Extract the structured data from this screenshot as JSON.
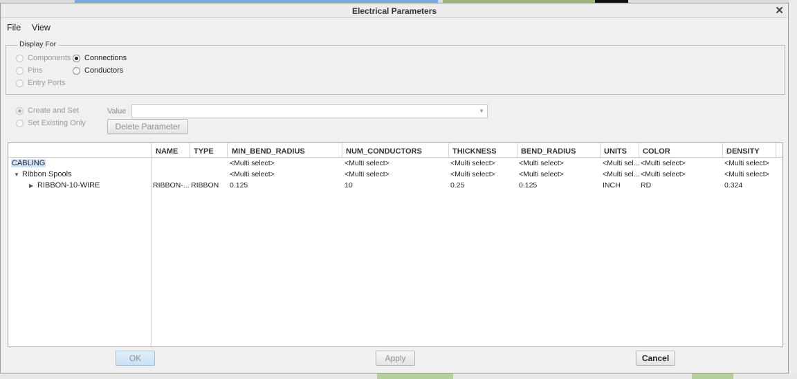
{
  "dialog": {
    "title": "Electrical Parameters"
  },
  "menu": {
    "file": "File",
    "view": "View"
  },
  "display_for": {
    "legend": "Display For",
    "options": [
      {
        "label": "Components",
        "checked": false,
        "enabled": false
      },
      {
        "label": "Connections",
        "checked": true,
        "enabled": true
      },
      {
        "label": "Pins",
        "checked": false,
        "enabled": false
      },
      {
        "label": "Conductors",
        "checked": false,
        "enabled": true
      },
      {
        "label": "Entry Ports",
        "checked": false,
        "enabled": false
      }
    ]
  },
  "mode": {
    "create_and_set": "Create and Set",
    "set_existing_only": "Set Existing Only"
  },
  "value": {
    "label": "Value",
    "current": ""
  },
  "buttons": {
    "delete_parameter": "Delete Parameter",
    "ok": "OK",
    "apply": "Apply",
    "cancel": "Cancel"
  },
  "table": {
    "columns": [
      "NAME",
      "TYPE",
      "MIN_BEND_RADIUS",
      "NUM_CONDUCTORS",
      "THICKNESS",
      "BEND_RADIUS",
      "UNITS",
      "COLOR",
      "DENSITY"
    ],
    "tree": [
      {
        "label": "CABLING",
        "selected": true
      },
      {
        "label": "Ribbon Spools",
        "expander": "expanded"
      },
      {
        "label": "RIBBON-10-WIRE",
        "expander": "collapsed"
      }
    ],
    "rows": [
      [
        "",
        "",
        "<Multi select>",
        "<Multi select>",
        "<Multi select>",
        "<Multi select>",
        "<Multi sel...",
        "<Multi select>",
        "<Multi select>"
      ],
      [
        "",
        "",
        "<Multi select>",
        "<Multi select>",
        "<Multi select>",
        "<Multi select>",
        "<Multi sel...",
        "<Multi select>",
        "<Multi select>"
      ],
      [
        "RIBBON-...",
        "RIBBON",
        "0.125",
        "10",
        "0.25",
        "0.125",
        "INCH",
        "RD",
        "0.324"
      ]
    ]
  }
}
